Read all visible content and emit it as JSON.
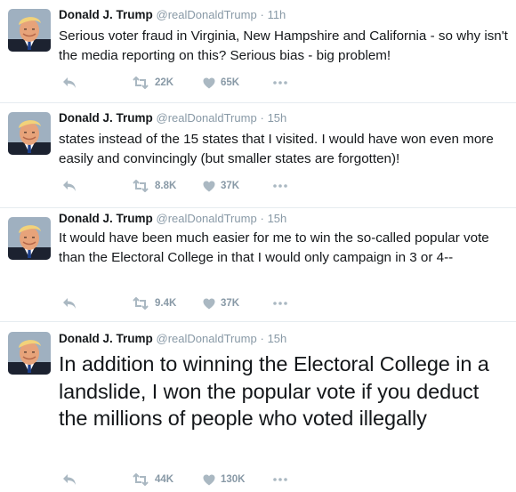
{
  "tweets": [
    {
      "name": "Donald J. Trump",
      "handle": "@realDonaldTrump",
      "separator": "·",
      "time": "11h",
      "text": "Serious voter fraud in Virginia, New Hampshire and California - so why isn't the media reporting on this? Serious bias - big problem!",
      "retweets": "22K",
      "likes": "65K"
    },
    {
      "name": "Donald J. Trump",
      "handle": "@realDonaldTrump",
      "separator": "·",
      "time": "15h",
      "text": "states instead of the 15 states that I visited. I would have won even more easily and convincingly (but smaller states are forgotten)!",
      "retweets": "8.8K",
      "likes": "37K"
    },
    {
      "name": "Donald J. Trump",
      "handle": "@realDonaldTrump",
      "separator": "·",
      "time": "15h",
      "text": "It would have been much easier for me to win the so-called popular vote than the Electoral College in that I would only campaign in 3 or 4--",
      "retweets": "9.4K",
      "likes": "37K"
    },
    {
      "name": "Donald J. Trump",
      "handle": "@realDonaldTrump",
      "separator": "·",
      "time": "15h",
      "text": "In addition to winning the Electoral College in a landslide, I won the popular vote if you deduct the millions of people who voted illegally",
      "retweets": "44K",
      "likes": "130K"
    }
  ],
  "icons": {
    "reply": "reply-icon",
    "retweet": "retweet-icon",
    "like": "heart-icon",
    "more": "more-icon"
  },
  "colors": {
    "icon_gray": "#aab8c2",
    "meta_gray": "#8899a6",
    "text": "#14171a",
    "divider": "#e6ecf0"
  }
}
